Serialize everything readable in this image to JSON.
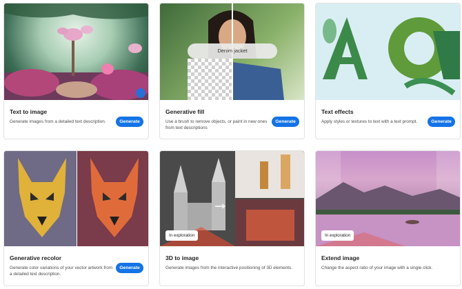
{
  "generate_label": "Generate",
  "badge_label": "In exploration",
  "fill_prompt": "Denim jacket",
  "cards": [
    {
      "title": "Text to image",
      "desc": "Generate images from a detailed text description."
    },
    {
      "title": "Generative fill",
      "desc": "Use a brush to remove objects, or paint in new ones from text descriptions"
    },
    {
      "title": "Text effects",
      "desc": "Apply styles or textures to text with a text prompt."
    },
    {
      "title": "Generative recolor",
      "desc": "Generate color variations of your vector artwork from a detailed text description."
    },
    {
      "title": "3D to image",
      "desc": "Generate images from the interactive positioning of 3D elements."
    },
    {
      "title": "Extend image",
      "desc": "Change the aspect ratio of your image with a single click."
    }
  ]
}
